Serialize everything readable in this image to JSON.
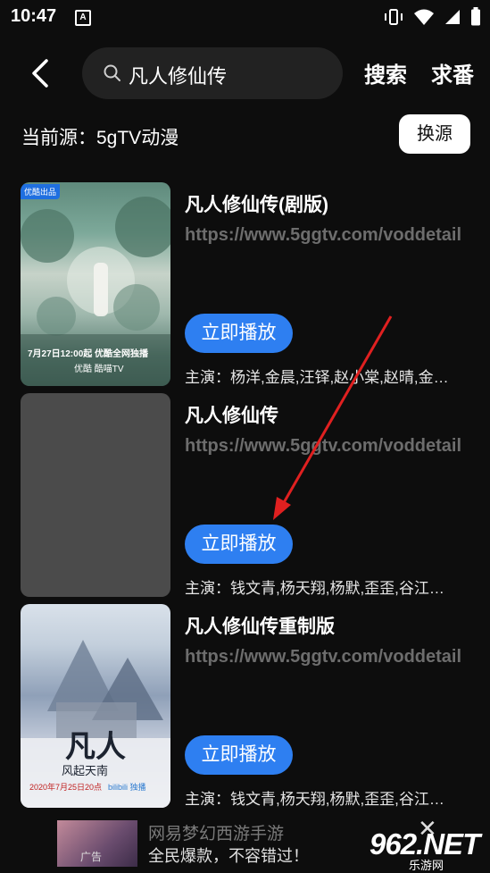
{
  "status": {
    "time": "10:47",
    "notif_letter": "A"
  },
  "header": {
    "search_value": "凡人修仙传",
    "search_button": "搜索",
    "request_button": "求番"
  },
  "source": {
    "label": "当前源：5gTV动漫",
    "switch_button": "换源"
  },
  "results": [
    {
      "title": "凡人修仙传(剧版)",
      "url": "https://www.5ggtv.com/voddetail",
      "play": "立即播放",
      "cast": "主演：杨洋,金晨,汪铎,赵小棠,赵晴,金…",
      "poster": {
        "badge": "优酷出品",
        "caption": "7月27日12:00起 优酷全网独播",
        "logos": "优酷  酷喵TV"
      }
    },
    {
      "title": "凡人修仙传",
      "url": "https://www.5ggtv.com/voddetail",
      "play": "立即播放",
      "cast": "主演：钱文青,杨天翔,杨默,歪歪,谷江…"
    },
    {
      "title": "凡人修仙传重制版",
      "url": "https://www.5ggtv.com/voddetail",
      "play": "立即播放",
      "cast": "主演：钱文青,杨天翔,杨默,歪歪,谷江…",
      "poster": {
        "big_title": "凡人",
        "subtitle": "风起天南",
        "date": "2020年7月25日20点",
        "logos": "bilibili 独播"
      }
    }
  ],
  "ad": {
    "tag": "广告",
    "title": "网易梦幻西游手游",
    "subtitle": "全民爆款，不容错过！",
    "close": "✕"
  },
  "watermark": {
    "main": "962.NET",
    "sub": "乐游网"
  },
  "colors": {
    "accent": "#2e7ff1",
    "annotation_arrow": "#e02020",
    "background": "#0d0d0d"
  }
}
